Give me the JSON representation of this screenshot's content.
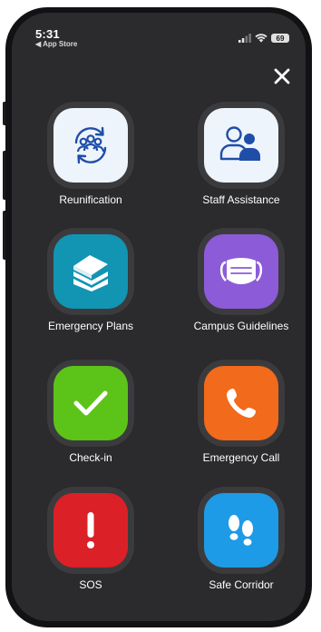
{
  "status_bar": {
    "time": "5:31",
    "back_label": "◀ App Store",
    "battery": "69"
  },
  "tiles": [
    {
      "label": "Reunification",
      "icon": "reunification-icon",
      "color": "#eef4fb"
    },
    {
      "label": "Staff Assistance",
      "icon": "staff-assistance-icon",
      "color": "#eef4fb"
    },
    {
      "label": "Emergency Plans",
      "icon": "book-stack-icon",
      "color": "#1294b3"
    },
    {
      "label": "Campus Guidelines",
      "icon": "face-mask-icon",
      "color": "#8c5bd8"
    },
    {
      "label": "Check-in",
      "icon": "checkmark-icon",
      "color": "#5cc418"
    },
    {
      "label": "Emergency Call",
      "icon": "phone-icon",
      "color": "#f26a1b"
    },
    {
      "label": "SOS",
      "icon": "exclamation-icon",
      "color": "#dc2027"
    },
    {
      "label": "Safe Corridor",
      "icon": "footprints-icon",
      "color": "#1e9be6"
    }
  ]
}
